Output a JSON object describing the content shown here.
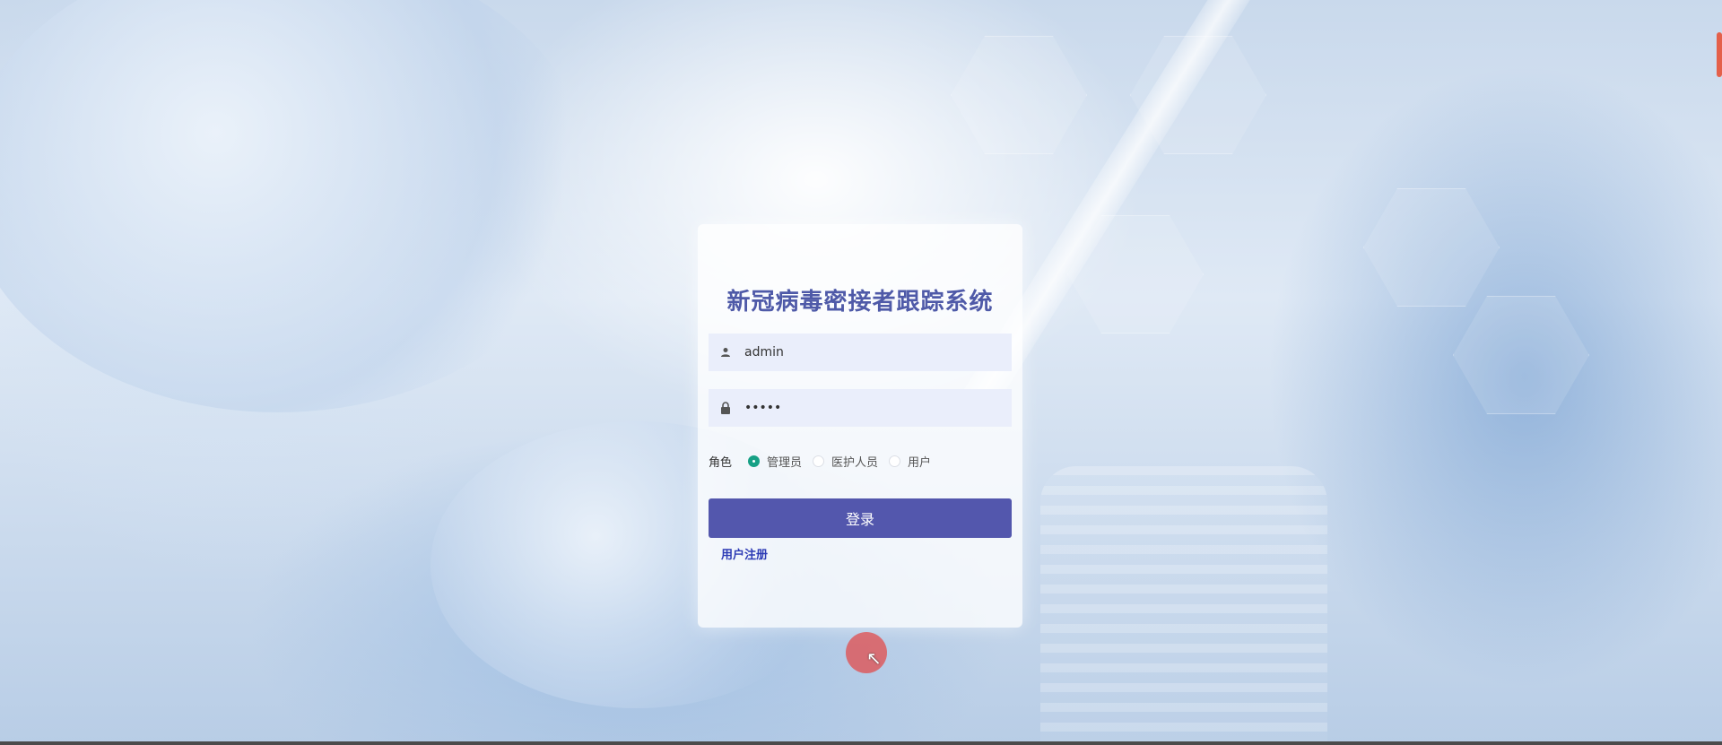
{
  "app": {
    "title": "新冠病毒密接者跟踪系统"
  },
  "login": {
    "username_value": "admin",
    "password_value": "•••••",
    "role_label": "角色",
    "roles": [
      {
        "label": "管理员",
        "checked": true
      },
      {
        "label": "医护人员",
        "checked": false
      },
      {
        "label": "用户",
        "checked": false
      }
    ],
    "submit_label": "登录",
    "register_label": "用户注册"
  },
  "icons": {
    "username": "user-icon",
    "password": "lock-icon"
  },
  "colors": {
    "title": "#4f5aa8",
    "button": "#5357ad",
    "radio_checked": "#16a085",
    "link": "#2d3bb5"
  }
}
